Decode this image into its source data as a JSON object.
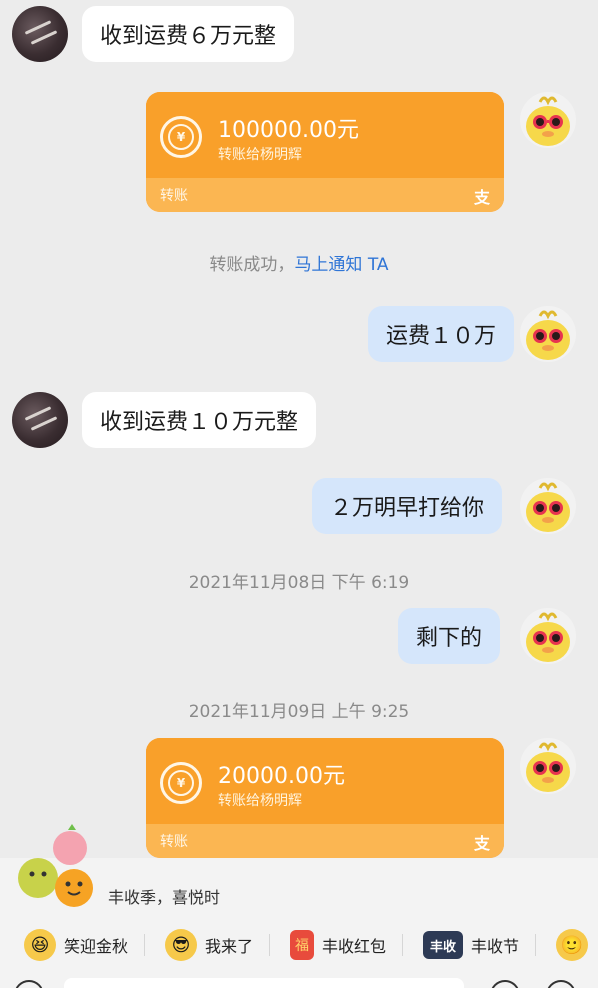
{
  "messages": {
    "m1_text": "收到运费６万元整",
    "m3_text": "运费１０万",
    "m4_text": "收到运费１０万元整",
    "m5_text": "２万明早打给你",
    "m6_text": "剩下的"
  },
  "transfer1": {
    "amount": "100000.00元",
    "to": "转账给杨明辉",
    "label": "转账",
    "brand": "支"
  },
  "system": {
    "success": "转账成功，",
    "notify_link": "马上通知 TA"
  },
  "timestamps": {
    "t1": "2021年11月08日 下午 6:19",
    "t2": "2021年11月09日 上午 9:25"
  },
  "transfer2": {
    "amount": "20000.00元",
    "to": "转账给杨明辉",
    "label": "转账",
    "brand": "支"
  },
  "theme": {
    "text": "丰收季，喜悦时"
  },
  "stickers": [
    {
      "label": "笑迎金秋",
      "icon": "laughing-face-icon"
    },
    {
      "label": "我来了",
      "icon": "sunglasses-face-icon"
    },
    {
      "label": "丰收红包",
      "icon": "red-envelope-icon"
    },
    {
      "label": "丰收节",
      "icon": "harvest-logo-icon"
    }
  ],
  "colors": {
    "background": "#ececec",
    "transfer_orange": "#f9a02a",
    "self_bubble": "#d5e6fb",
    "link_blue": "#2f75d6"
  }
}
